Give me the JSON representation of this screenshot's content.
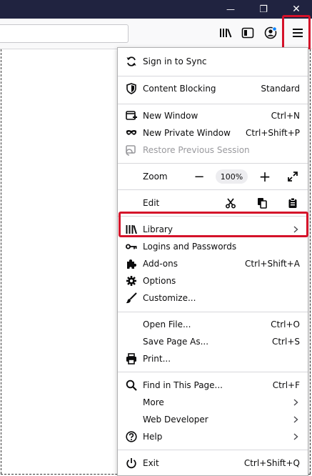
{
  "window": {
    "minimize": "—",
    "restore": "❐",
    "close": "✕"
  },
  "toolbar": {
    "library_icon": "library-icon",
    "sidebar_icon": "sidebar-icon",
    "account_icon": "account-icon",
    "menu_icon": "hamburger-menu-icon"
  },
  "colors": {
    "titlebar": "#202340",
    "highlight": "#d5122a",
    "accent": "#0a84ff"
  },
  "menu": {
    "sync": {
      "label": "Sign in to Sync"
    },
    "content_blocking": {
      "label": "Content Blocking",
      "value": "Standard"
    },
    "new_window": {
      "label": "New Window",
      "shortcut": "Ctrl+N"
    },
    "new_private_window": {
      "label": "New Private Window",
      "shortcut": "Ctrl+Shift+P"
    },
    "restore_session": {
      "label": "Restore Previous Session"
    },
    "zoom": {
      "label": "Zoom",
      "minus": "−",
      "value": "100%",
      "plus": "+"
    },
    "edit": {
      "label": "Edit"
    },
    "library": {
      "label": "Library"
    },
    "logins": {
      "label": "Logins and Passwords"
    },
    "addons": {
      "label": "Add-ons",
      "shortcut": "Ctrl+Shift+A"
    },
    "options": {
      "label": "Options"
    },
    "customize": {
      "label": "Customize..."
    },
    "open_file": {
      "label": "Open File...",
      "shortcut": "Ctrl+O"
    },
    "save_page": {
      "label": "Save Page As...",
      "shortcut": "Ctrl+S"
    },
    "print": {
      "label": "Print..."
    },
    "find": {
      "label": "Find in This Page...",
      "shortcut": "Ctrl+F"
    },
    "more": {
      "label": "More"
    },
    "web_developer": {
      "label": "Web Developer"
    },
    "help": {
      "label": "Help"
    },
    "exit": {
      "label": "Exit",
      "shortcut": "Ctrl+Shift+Q"
    }
  }
}
